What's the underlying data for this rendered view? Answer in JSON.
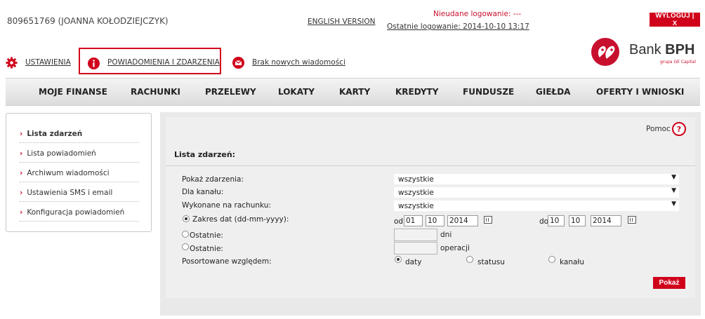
{
  "header": {
    "account": "809651769 (JOANNA KOŁODZIEJCZYK)",
    "english_version": "ENGLISH VERSION",
    "failed_logins": "Nieudane logowanie: ---",
    "last_login": "Ostatnie logowanie: 2014-10-10 13:17",
    "logout": "WYLOGUJ | X"
  },
  "toolbar": {
    "settings": "USTAWIENIA",
    "notifications": "POWIADOMIENIA I ZDARZENIA",
    "messages": "Brak nowych wiadomości"
  },
  "logo": {
    "name_a": "Bank ",
    "name_b": "BPH",
    "sub": "grupa GE Capital"
  },
  "nav": [
    "MOJE FINANSE",
    "RACHUNKI",
    "PRZELEWY",
    "LOKATY",
    "KARTY",
    "KREDYTY",
    "FUNDUSZE",
    "GIEŁDA",
    "OFERTY I WNIOSKI"
  ],
  "sidebar": {
    "items": [
      {
        "label": "Lista zdarzeń",
        "active": true
      },
      {
        "label": "Lista powiadomień"
      },
      {
        "label": "Archiwum wiadomości"
      },
      {
        "label": "Ustawienia SMS i email"
      },
      {
        "label": "Konfiguracja powiadomień"
      }
    ]
  },
  "main": {
    "help": "Pomoc",
    "help_symbol": "?",
    "title": "Lista zdarzeń:",
    "show_events_label": "Pokaż zdarzenia:",
    "show_events_value": "wszystkie",
    "channel_label": "Dla kanału:",
    "channel_value": "wszystkie",
    "account_label": "Wykonane na rachunku:",
    "account_value": "wszystkie",
    "date_range_label": "Zakres dat (dd-mm-yyyy):",
    "from_label": "od",
    "from_day": "01",
    "from_month": "10",
    "from_year": "2014",
    "to_label": "do",
    "to_day": "10",
    "to_month": "10",
    "to_year": "2014",
    "last_days_label": "Ostatnie:",
    "days_unit": "dni",
    "last_ops_label": "Ostatnie:",
    "ops_unit": "operacji",
    "sort_label": "Posortowane względem:",
    "sort_date": "daty",
    "sort_status": "statusu",
    "sort_channel": "kanału",
    "show_button": "Pokaż"
  },
  "colors": {
    "brand_red": "#d0021b",
    "panel_bg": "#efefef"
  }
}
